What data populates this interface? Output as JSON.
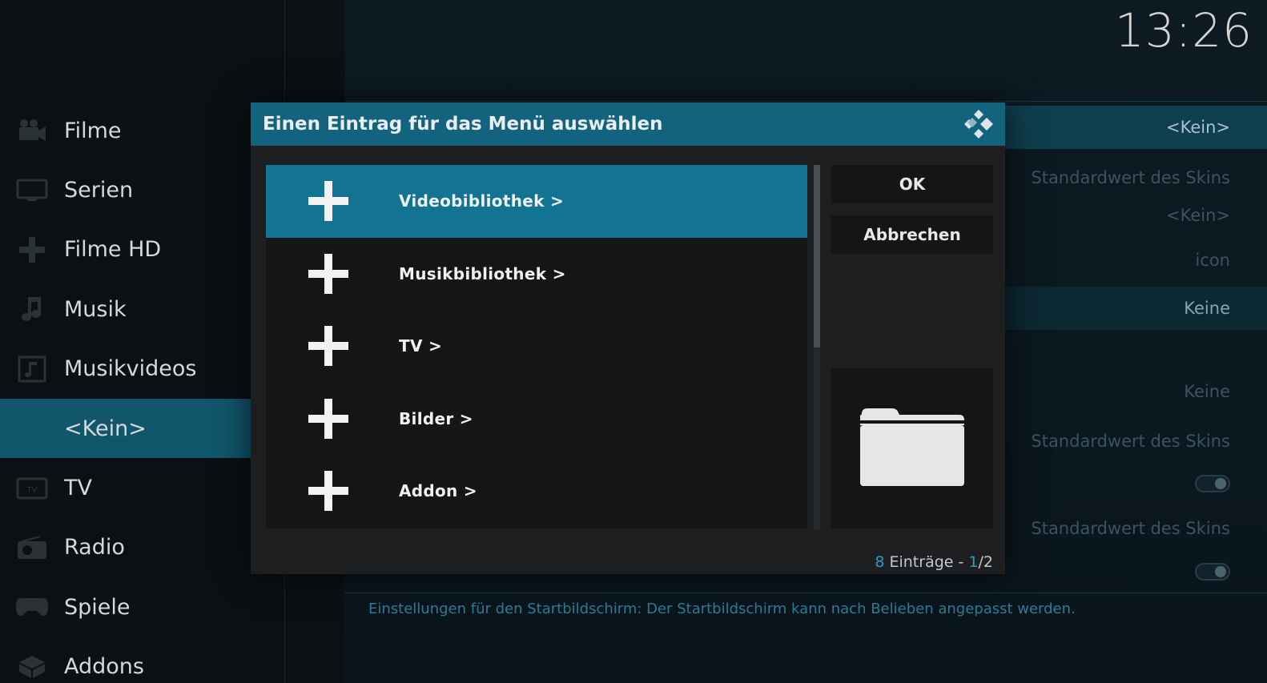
{
  "clock": "13:26",
  "sidebar": {
    "items": [
      {
        "label": "Filme",
        "icon": "film-camera-icon"
      },
      {
        "label": "Serien",
        "icon": "tv-monitor-icon"
      },
      {
        "label": "Filme HD",
        "icon": "plus-icon"
      },
      {
        "label": "Musik",
        "icon": "music-note-icon"
      },
      {
        "label": "Musikvideos",
        "icon": "music-video-icon"
      },
      {
        "label": "<Kein>",
        "icon": ""
      },
      {
        "label": "TV",
        "icon": "tv-icon"
      },
      {
        "label": "Radio",
        "icon": "radio-icon"
      },
      {
        "label": "Spiele",
        "icon": "gamepad-icon"
      },
      {
        "label": "Addons",
        "icon": "addons-box-icon"
      }
    ],
    "active_index": 5
  },
  "settings": {
    "rows": [
      {
        "value": "<Kein>"
      },
      {
        "value": "Standardwert des Skins"
      },
      {
        "value": "<Kein>"
      },
      {
        "value": "icon"
      },
      {
        "value": "Keine"
      },
      {
        "value": "Keine"
      },
      {
        "value": "Standardwert des Skins"
      },
      {
        "value": "Standardwert des Skins"
      }
    ],
    "footer": "Einstellungen für den Startbildschirm: Der Startbildschirm kann nach Belieben angepasst werden."
  },
  "dialog": {
    "title": "Einen Eintrag für das Menü auswählen",
    "items": [
      {
        "label": "Videobibliothek  >"
      },
      {
        "label": "Musikbibliothek  >"
      },
      {
        "label": "TV  >"
      },
      {
        "label": "Bilder  >"
      },
      {
        "label": "Addon  >"
      }
    ],
    "focused_index": 0,
    "ok_label": "OK",
    "cancel_label": "Abbrechen",
    "footer": {
      "count": "8",
      "entries_text": " Einträge - ",
      "page_current": "1",
      "page_total": "/2"
    },
    "accent_color": "#13637f",
    "focus_color": "#137393"
  }
}
